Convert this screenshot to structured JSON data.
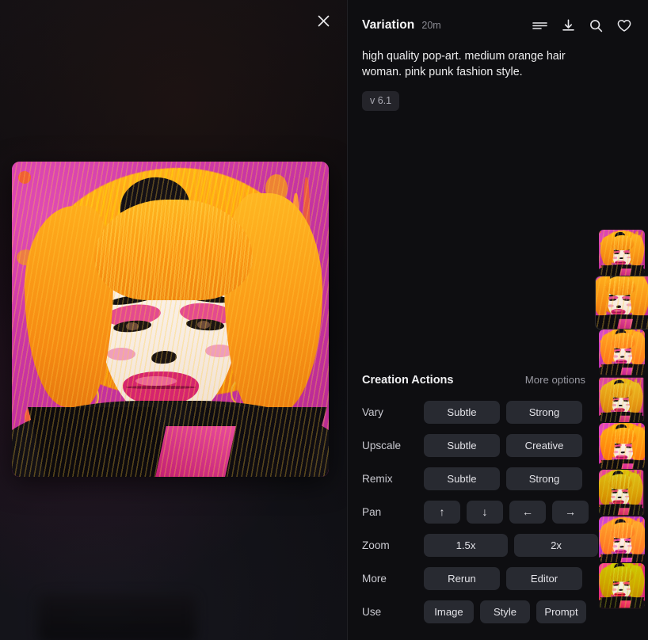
{
  "viewer": {
    "close_icon": "close-icon",
    "artwork_alt": "pop-art portrait of woman with orange hair and pink punk styling"
  },
  "detail": {
    "title": "Variation",
    "elapsed": "20m",
    "header_icons": [
      {
        "name": "list-icon",
        "label": "List"
      },
      {
        "name": "download-icon",
        "label": "Download"
      },
      {
        "name": "search-icon",
        "label": "Search"
      },
      {
        "name": "heart-icon",
        "label": "Favorite"
      }
    ],
    "prompt": "high quality pop-art. medium orange hair woman. pink punk fashion style.",
    "version_badge": "v 6.1"
  },
  "filmstrip": {
    "items": [
      {
        "name": "thumbnail-1",
        "selected": false
      },
      {
        "name": "thumbnail-2",
        "selected": true
      },
      {
        "name": "thumbnail-3",
        "selected": false
      },
      {
        "name": "thumbnail-4",
        "selected": false
      },
      {
        "name": "thumbnail-5",
        "selected": false
      },
      {
        "name": "thumbnail-6",
        "selected": false
      },
      {
        "name": "thumbnail-7",
        "selected": false
      },
      {
        "name": "thumbnail-8",
        "selected": false
      }
    ]
  },
  "actions": {
    "title": "Creation Actions",
    "more_options": "More options",
    "rows": [
      {
        "label": "Vary",
        "buttons": [
          "Subtle",
          "Strong"
        ]
      },
      {
        "label": "Upscale",
        "buttons": [
          "Subtle",
          "Creative"
        ]
      },
      {
        "label": "Remix",
        "buttons": [
          "Subtle",
          "Strong"
        ]
      },
      {
        "label": "Pan",
        "buttons": [
          "↑",
          "↓",
          "←",
          "→"
        ]
      },
      {
        "label": "Zoom",
        "buttons": [
          "1.5x",
          "2x"
        ]
      },
      {
        "label": "More",
        "buttons": [
          "Rerun",
          "Editor"
        ]
      },
      {
        "label": "Use",
        "buttons": [
          "Image",
          "Style",
          "Prompt"
        ]
      }
    ]
  },
  "colors": {
    "background": "#0d0d0f",
    "panel": "#0e0e11",
    "button": "#282a31",
    "text_primary": "#f0f0f2",
    "text_muted": "#9a9aa3",
    "art_magenta": "#d13aa8",
    "art_orange": "#ffa015",
    "art_pink": "#e23c88"
  }
}
